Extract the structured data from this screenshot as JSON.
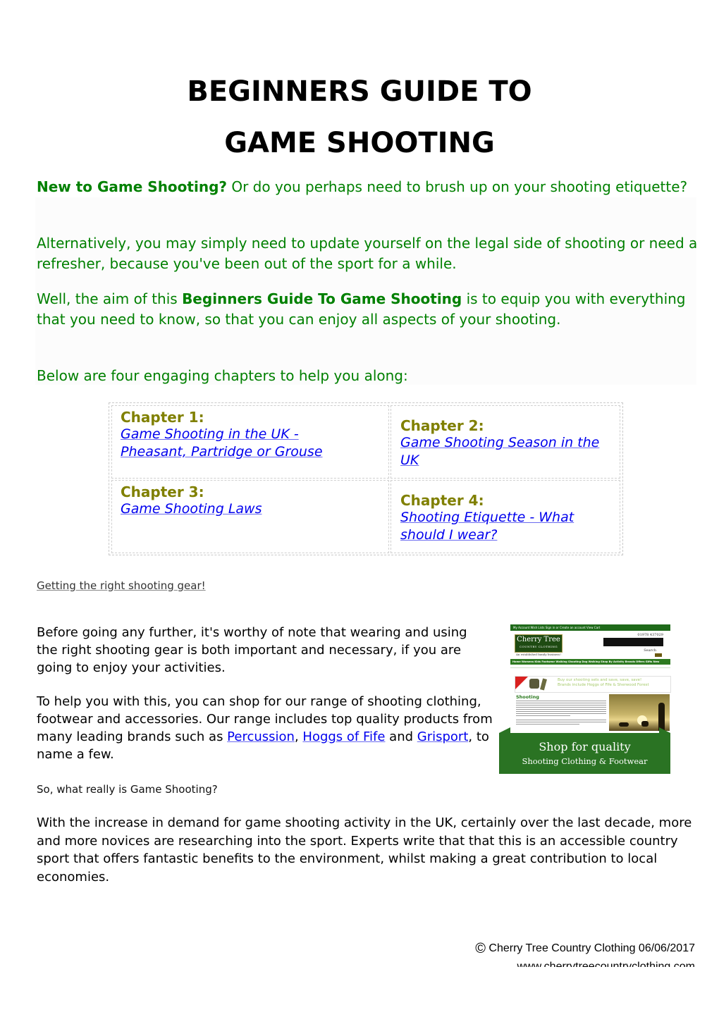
{
  "title": {
    "line1": "BEGINNERS GUIDE TO",
    "line2": "GAME SHOOTING"
  },
  "intro": {
    "p1_bold": "New to Game Shooting?",
    "p1_rest": " Or do you perhaps need to brush up on your shooting etiquette?",
    "p2": "Alternatively, you may simply need to update yourself on the legal side of shooting or need a refresher, because you've been out of the sport for a while.",
    "p3_before": "Well, the aim of this ",
    "p3_bold": "Beginners Guide To Game Shooting",
    "p3_after": " is to equip you with everything that you need to know, so that you can enjoy all aspects of your shooting.",
    "p4": "Below are four engaging chapters to help you along:"
  },
  "chapters": [
    {
      "label": "Chapter 1:",
      "link": "Game Shooting in the UK - Pheasant, Partridge or Grouse"
    },
    {
      "label": "Chapter 2:",
      "link": "Game Shooting Season in the UK"
    },
    {
      "label": "Chapter 3:",
      "link": "Game Shooting Laws"
    },
    {
      "label": "Chapter 4:",
      "link": "Shooting Etiquette - What should I wear?"
    }
  ],
  "gear": {
    "heading": "Getting the right shooting gear!",
    "p1": "Before going any further, it's worthy of note that wearing and using the right shooting gear is both important and necessary, if you are going to enjoy your activities.",
    "p2_before": "To help you with this, you can shop for our range of shooting clothing, footwear and accessories. Our range includes top quality products from many leading brands such as ",
    "brands": [
      "Percussion",
      "Hoggs of Fife",
      "Grisport"
    ],
    "sep1": ", ",
    "sep2": " and ",
    "p2_after": ", to name a few."
  },
  "what_is": {
    "heading": "So, what really is Game Shooting?",
    "p1": "With the increase in demand for game shooting activity in the UK, certainly over the last decade, more and more novices are researching into the sport. Experts write that that this is an accessible country sport that offers fantastic benefits to the environment, whilst making a great contribution to local economies."
  },
  "banner": {
    "top_links": "My Account   Wish Lists   Sign in or Create an account   View Cart",
    "logo_main": "Cherry Tree",
    "logo_sub": "COUNTRY CLOTHING",
    "tagline": "An established family business!",
    "phone": "01978 437029",
    "search_label": "Search",
    "nav": "Home  Womens  Kids  Footwear  Walking  Shooting  Dog Walking  Shop By Activity  Brands  Offers  Gifts  New",
    "promo_line1": "Buy our shooting sets and save, save, save!",
    "promo_line2": "Brands include Hoggs of Fife & Sherwood Forest",
    "section_heading": "Shooting",
    "cta_line1": "Shop for quality",
    "cta_line2": "Shooting Clothing & Footwear"
  },
  "footer": {
    "copyright_symbol": "©",
    "copyright": " Cherry Tree Country Clothing 06/06/2017",
    "website": "www.cherrytreecountryclothing.com"
  }
}
